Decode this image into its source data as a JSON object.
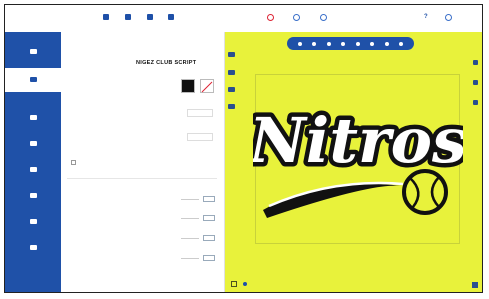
{
  "app": {
    "logo_prefix": "",
    "logo_name": ""
  },
  "toolbar": {
    "buttons": [
      {
        "icon": "file-icon",
        "label": ""
      },
      {
        "icon": "save-icon",
        "label": ""
      },
      {
        "icon": "image-icon",
        "label": ""
      },
      {
        "icon": "grid-icon",
        "label": ""
      }
    ],
    "center": [
      {
        "icon": "undo-icon",
        "label": ""
      },
      {
        "icon": "redo-icon",
        "label": ""
      },
      {
        "icon": "preview-icon",
        "label": ""
      }
    ],
    "help": "?",
    "right_label": ""
  },
  "sidebar": {
    "items": [
      {
        "icon": "templates-icon",
        "label": ""
      },
      {
        "icon": "edit-icon",
        "label": ""
      },
      {
        "icon": "add-text-icon",
        "label": ""
      },
      {
        "icon": "add-clipart-icon",
        "label": ""
      },
      {
        "icon": "add-layers-icon",
        "label": ""
      },
      {
        "icon": "upload-icon",
        "label": ""
      },
      {
        "icon": "mirror-icon",
        "label": ""
      },
      {
        "icon": "finish-icon",
        "label": ""
      }
    ],
    "active_index": 1
  },
  "panel": {
    "title": "",
    "text_label": "",
    "font_name": "NIGEZ CLUB SCRIPT",
    "color_label": "",
    "color_value": "#111111",
    "weight_label": "",
    "weight_value": "",
    "height_label": "",
    "height_value": "",
    "checkbox_label": "",
    "rows": [
      {
        "label": "",
        "value": ""
      },
      {
        "label": "",
        "value": ""
      },
      {
        "label": "",
        "value": ""
      },
      {
        "label": "",
        "value": ""
      }
    ]
  },
  "canvas": {
    "background": "#e8f23b",
    "artboard_label": "",
    "design_text": "Nitros",
    "zoom_label": "",
    "footer_line1": "",
    "footer_line2": ""
  }
}
